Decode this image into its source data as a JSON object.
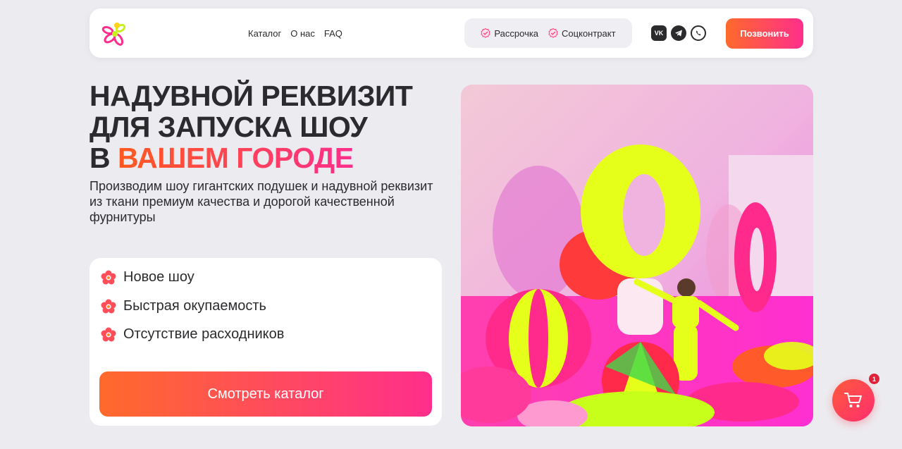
{
  "header": {
    "nav": [
      "Каталог",
      "О нас",
      "FAQ"
    ],
    "badges": [
      "Рассрочка",
      "Соцконтракт"
    ],
    "socials": [
      "vk-icon",
      "telegram-icon",
      "whatsapp-icon"
    ],
    "call_label": "Позвонить"
  },
  "hero": {
    "title_line1": "НАДУВНОЙ РЕКВИЗИТ",
    "title_line2": "ДЛЯ ЗАПУСКА ШОУ",
    "title_line3_prefix": "В",
    "title_line3_accent": "ВАШЕМ ГОРОДЕ",
    "subtitle": "Производим шоу гигантских подушек и надувной реквизит из ткани премиум качества и дорогой качественной фурнитуры"
  },
  "features": [
    "Новое шоу",
    "Быстрая окупаемость",
    "Отсутствие расходников"
  ],
  "cta_label": "Смотреть каталог",
  "cart": {
    "count": "1"
  },
  "colors": {
    "accent_start": "#ff6a2b",
    "accent_end": "#ff2e8c",
    "background": "#ececf0"
  }
}
